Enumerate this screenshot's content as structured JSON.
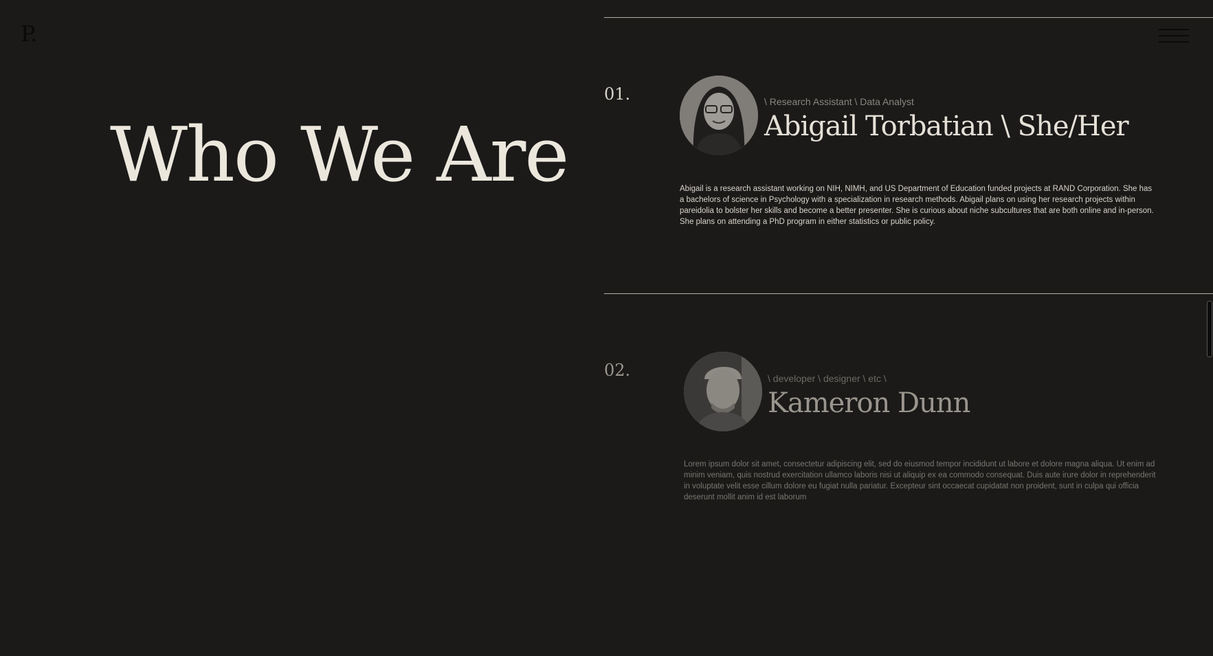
{
  "header": {
    "logo": "P."
  },
  "hero": {
    "title": "Who We Are"
  },
  "members": [
    {
      "number": "01.",
      "roles": "\\ Research Assistant \\ Data Analyst",
      "name": "Abigail Torbatian \\ She/Her",
      "bio": "Abigail is a research assistant working on NIH, NIMH, and US Department of Education funded projects at RAND Corporation. She has a bachelors of science in Psychology with a specialization in research methods. Abigail plans on using her research projects within pareidolia to bolster her skills and become a better presenter. She is curious about niche subcultures that are both online and in-person. She plans on attending a PhD program in either statistics or public policy."
    },
    {
      "number": "02.",
      "roles": "\\ developer \\ designer \\ etc \\",
      "name": "Kameron Dunn",
      "bio": "Lorem ipsum dolor sit amet, consectetur adipiscing elit, sed do eiusmod tempor incididunt ut labore et dolore magna aliqua. Ut enim ad minim veniam, quis nostrud exercitation ullamco laboris nisi ut aliquip ex ea commodo consequat. Duis aute irure dolor in reprehenderit in voluptate velit esse cillum dolore eu fugiat nulla pariatur. Excepteur sint occaecat cupidatat non proident, sunt in culpa qui officia deserunt mollit anim id est laborum"
    }
  ],
  "colors": {
    "background": "#1b1a19",
    "heading": "#ece7dd",
    "divider": "#b5b0a6"
  },
  "icons": {
    "menu": "hamburger-menu-icon"
  }
}
